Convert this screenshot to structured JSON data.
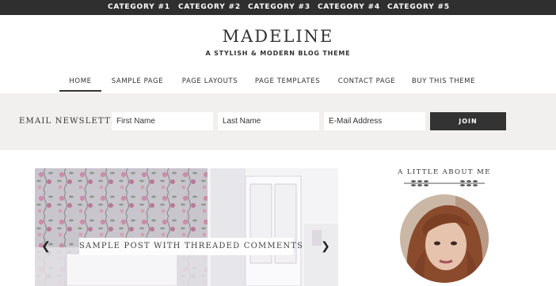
{
  "categories": [
    "CATEGORY #1",
    "CATEGORY #2",
    "CATEGORY #3",
    "CATEGORY #4",
    "CATEGORY #5"
  ],
  "site": {
    "title": "MADELINE",
    "tagline": "A STYLISH & MODERN BLOG THEME"
  },
  "nav": [
    "HOME",
    "SAMPLE PAGE",
    "PAGE LAYOUTS",
    "PAGE TEMPLATES",
    "CONTACT PAGE",
    "BUY THIS THEME"
  ],
  "nav_active": "HOME",
  "newsletter": {
    "label": "EMAIL NEWSLETTER",
    "first_name_placeholder": "First Name",
    "last_name_placeholder": "Last Name",
    "email_placeholder": "E-Mail Address",
    "join_label": "JOIN"
  },
  "slider": {
    "caption": "SAMPLE POST WITH THREADED COMMENTS",
    "prev_icon": "chevron-left-icon",
    "next_icon": "chevron-right-icon"
  },
  "sidebar": {
    "widget_title": "A LITTLE ABOUT ME"
  },
  "colors": {
    "topbar": "#2f2f2f",
    "newsletter_bg": "#f1f0ee",
    "button": "#333333",
    "text": "#333333"
  }
}
